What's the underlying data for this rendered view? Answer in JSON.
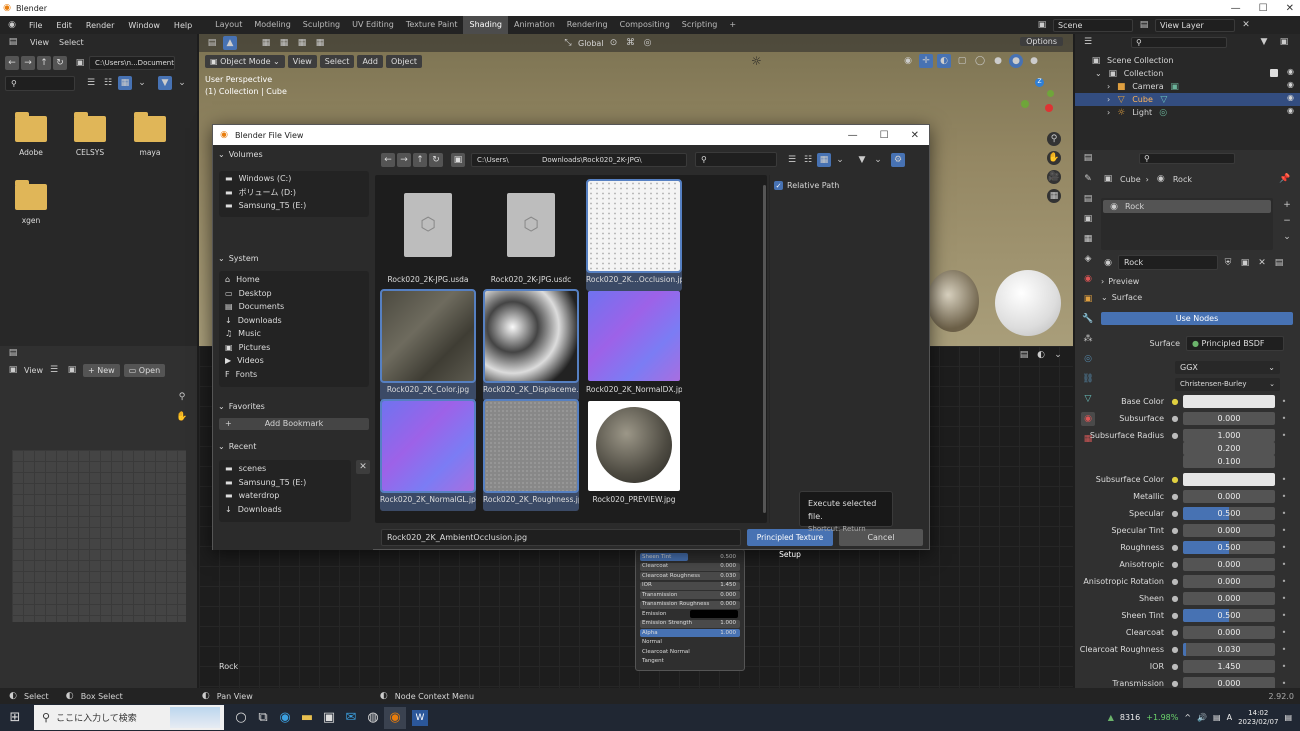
{
  "app": {
    "title": "Blender",
    "version": "2.92.0"
  },
  "menus": [
    "File",
    "Edit",
    "Render",
    "Window",
    "Help"
  ],
  "workspaces": [
    "Layout",
    "Modeling",
    "Sculpting",
    "UV Editing",
    "Texture Paint",
    "Shading",
    "Animation",
    "Rendering",
    "Compositing",
    "Scripting"
  ],
  "scene": {
    "name": "Scene",
    "view_layer": "View Layer"
  },
  "left_browser": {
    "menus": [
      "View",
      "Select"
    ],
    "path": "C:\\Users\\n...Documents\\",
    "folders": [
      "Adobe",
      "CELSYS",
      "maya",
      "xgen"
    ]
  },
  "image_editor": {
    "view": "View",
    "new": "New",
    "open": "Open"
  },
  "viewport": {
    "mode": "Object Mode",
    "menus": [
      "View",
      "Select",
      "Add",
      "Object"
    ],
    "transform": "Global",
    "options": "Options",
    "info_line1": "User Perspective",
    "info_line2": "(1) Collection | Cube"
  },
  "node_editor": {
    "material_label": "Rock",
    "context_menu": "Node Context Menu"
  },
  "outliner": {
    "items": [
      {
        "label": "Scene Collection"
      },
      {
        "label": "Collection"
      },
      {
        "label": "Camera"
      },
      {
        "label": "Cube"
      },
      {
        "label": "Light"
      }
    ]
  },
  "properties": {
    "breadcrumb_object": "Cube",
    "breadcrumb_material": "Rock",
    "slot": "Rock",
    "material_name": "Rock",
    "preview_label": "Preview",
    "surface_label": "Surface",
    "use_nodes": "Use Nodes",
    "surface_shader_label": "Surface",
    "surface_shader": "Principled BSDF",
    "distribution": "GGX",
    "subsurface_method": "Christensen-Burley",
    "rows": [
      {
        "label": "Base Color",
        "value": "",
        "fill": 0,
        "color": "#e6e6e6",
        "dot": "●"
      },
      {
        "label": "Subsurface",
        "value": "0.000",
        "fill": 0,
        "dot": "●"
      },
      {
        "label": "Subsurface Radius",
        "value": "1.000",
        "fill": 0,
        "dot": "●"
      },
      {
        "label": "",
        "value": "0.200",
        "fill": 0,
        "dot": ""
      },
      {
        "label": "",
        "value": "0.100",
        "fill": 0,
        "dot": ""
      },
      {
        "label": "Subsurface Color",
        "value": "",
        "fill": 0,
        "color": "#e6e6e6",
        "dot": "●"
      },
      {
        "label": "Metallic",
        "value": "0.000",
        "fill": 0,
        "dot": "●"
      },
      {
        "label": "Specular",
        "value": "0.500",
        "fill": 0.5,
        "dot": "●"
      },
      {
        "label": "Specular Tint",
        "value": "0.000",
        "fill": 0,
        "dot": "●"
      },
      {
        "label": "Roughness",
        "value": "0.500",
        "fill": 0.5,
        "dot": "●"
      },
      {
        "label": "Anisotropic",
        "value": "0.000",
        "fill": 0,
        "dot": "●"
      },
      {
        "label": "Anisotropic Rotation",
        "value": "0.000",
        "fill": 0,
        "dot": "●"
      },
      {
        "label": "Sheen",
        "value": "0.000",
        "fill": 0,
        "dot": "●"
      },
      {
        "label": "Sheen Tint",
        "value": "0.500",
        "fill": 0.5,
        "dot": "●"
      },
      {
        "label": "Clearcoat",
        "value": "0.000",
        "fill": 0,
        "dot": "●"
      },
      {
        "label": "Clearcoat Roughness",
        "value": "0.030",
        "fill": 0.03,
        "dot": "●"
      },
      {
        "label": "IOR",
        "value": "1.450",
        "fill": 0,
        "dot": "●"
      },
      {
        "label": "Transmission",
        "value": "0.000",
        "fill": 0,
        "dot": "●"
      }
    ]
  },
  "node": {
    "rows": [
      {
        "label": "Sheen Tint",
        "value": "0.500",
        "fill": 0.5
      },
      {
        "label": "Clearcoat",
        "value": "0.000",
        "fill": 0
      },
      {
        "label": "Clearcoat Roughness",
        "value": "0.030",
        "fill": 0
      },
      {
        "label": "IOR",
        "value": "1.450",
        "fill": 0
      },
      {
        "label": "Transmission",
        "value": "0.000",
        "fill": 0
      },
      {
        "label": "Transmission Roughness",
        "value": "0.000",
        "fill": 0
      },
      {
        "label": "Emission",
        "value": "",
        "fill": 0
      },
      {
        "label": "Emission Strength",
        "value": "1.000",
        "fill": 0
      },
      {
        "label": "Alpha",
        "value": "1.000",
        "fill": 1
      },
      {
        "label": "Normal",
        "value": "",
        "fill": 0
      },
      {
        "label": "Clearcoat Normal",
        "value": "",
        "fill": 0
      },
      {
        "label": "Tangent",
        "value": "",
        "fill": 0
      }
    ]
  },
  "dialog": {
    "title": "Blender File View",
    "volumes_header": "Volumes",
    "volumes": [
      "Windows (C:)",
      "ボリューム (D:)",
      "Samsung_T5 (E:)"
    ],
    "system_header": "System",
    "system": [
      "Home",
      "Desktop",
      "Documents",
      "Downloads",
      "Music",
      "Pictures",
      "Videos",
      "Fonts"
    ],
    "favorites_header": "Favorites",
    "add_bookmark": "Add Bookmark",
    "recent_header": "Recent",
    "recent": [
      "scenes",
      "Samsung_T5 (E:)",
      "waterdrop",
      "Downloads"
    ],
    "path": "C:\\Users\\               Downloads\\Rock020_2K-JPG\\",
    "relative_path": "Relative Path",
    "files": [
      {
        "name": "Rock020_2K-JPG.usda",
        "kind": "usd"
      },
      {
        "name": "Rock020_2K-JPG.usdc",
        "kind": "usd"
      },
      {
        "name": "Rock020_2K...Occlusion.jpg",
        "kind": "ao"
      },
      {
        "name": "Rock020_2K_Color.jpg",
        "kind": "color"
      },
      {
        "name": "Rock020_2K_Displaceme...",
        "kind": "disp"
      },
      {
        "name": "Rock020_2K_NormalDX.jpg",
        "kind": "normal"
      },
      {
        "name": "Rock020_2K_NormalGL.jpg",
        "kind": "normal"
      },
      {
        "name": "Rock020_2K_Roughness.jpg",
        "kind": "rough"
      },
      {
        "name": "Rock020_PREVIEW.jpg",
        "kind": "preview"
      }
    ],
    "filename": "Rock020_2K_AmbientOcclusion.jpg",
    "execute_button": "Principled Texture Setup",
    "cancel_button": "Cancel",
    "tooltip_line1": "Execute selected file.",
    "tooltip_line2": "Shortcut: Return"
  },
  "status": {
    "select": "Select",
    "box_select": "Box Select",
    "pan_view": "Pan View",
    "node_context": "Node Context Menu"
  },
  "taskbar": {
    "search_placeholder": "ここに入力して検索",
    "stock_value": "8316",
    "stock_change": "+1.98%",
    "time": "14:02",
    "date": "2023/02/07"
  }
}
